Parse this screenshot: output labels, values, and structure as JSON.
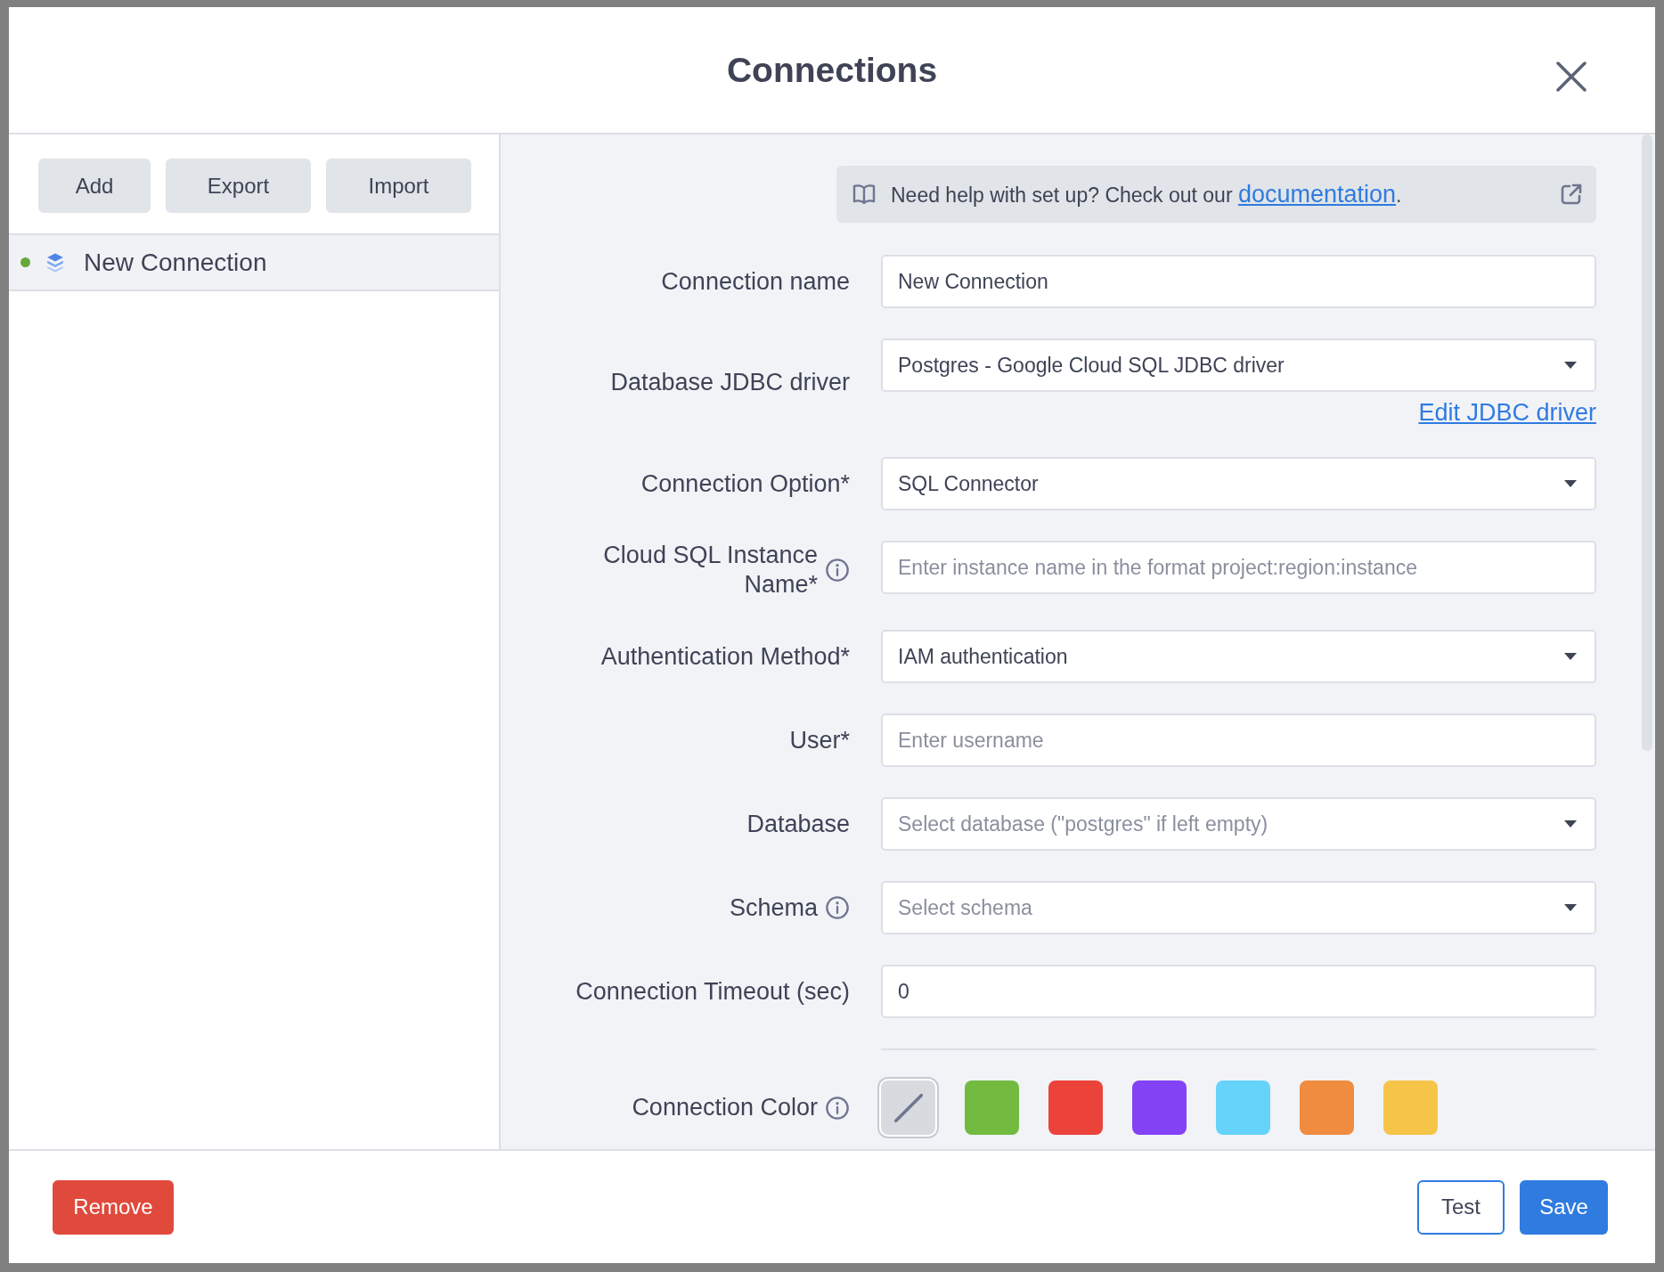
{
  "dialog": {
    "title": "Connections"
  },
  "sidebar": {
    "buttons": [
      "Add",
      "Export",
      "Import"
    ],
    "items": [
      {
        "label": "New Connection",
        "selected": true,
        "color": "#64a93c"
      }
    ]
  },
  "help": {
    "text": "Need help with set up? Check out our ",
    "link": "documentation",
    "suffix": "."
  },
  "form": {
    "fields": [
      {
        "label": "Connection name",
        "kind": "text",
        "value": "New Connection",
        "info": false
      },
      {
        "label": "Database JDBC driver",
        "kind": "select",
        "value": "Postgres - Google Cloud SQL JDBC driver",
        "info": false,
        "link": "Edit JDBC driver"
      },
      {
        "label": "Connection Option*",
        "kind": "select",
        "value": "SQL Connector",
        "info": false
      },
      {
        "label": "Cloud SQL Instance Name*",
        "kind": "text",
        "placeholder": "Enter instance name in the format project:region:instance",
        "info": true
      },
      {
        "label": "Authentication Method*",
        "kind": "select",
        "value": "IAM authentication",
        "info": false
      },
      {
        "label": "User*",
        "kind": "text",
        "placeholder": "Enter username",
        "info": false
      },
      {
        "label": "Database",
        "kind": "select",
        "placeholder": "Select database (\"postgres\" if left empty)",
        "info": false
      },
      {
        "label": "Schema",
        "kind": "select",
        "placeholder": "Select schema",
        "info": true
      },
      {
        "label": "Connection Timeout (sec)",
        "kind": "text",
        "value": "0",
        "info": false
      }
    ],
    "color_label": "Connection Color",
    "colors": [
      {
        "kind": "none",
        "selected": true
      },
      {
        "kind": "color",
        "color": "#72bb40",
        "selected": false
      },
      {
        "kind": "color",
        "color": "#eb433a",
        "selected": false
      },
      {
        "kind": "color",
        "color": "#8442f5",
        "selected": false
      },
      {
        "kind": "color",
        "color": "#66d3fb",
        "selected": false
      },
      {
        "kind": "color",
        "color": "#ef8c40",
        "selected": false
      },
      {
        "kind": "color",
        "color": "#f6c449",
        "selected": false
      }
    ]
  },
  "footer": {
    "remove": "Remove",
    "test": "Test",
    "save": "Save"
  }
}
